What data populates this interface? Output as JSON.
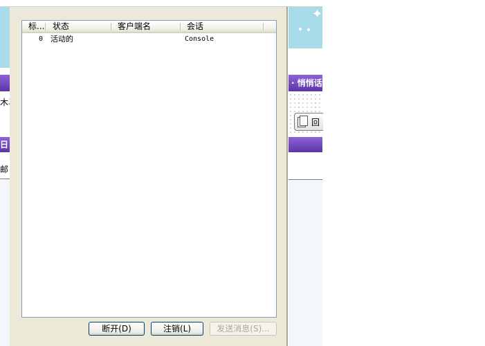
{
  "background": {
    "left_fragments": [
      "木马",
      "日",
      "邮"
    ],
    "right_banner": "· 悄悄话",
    "reply_button": "回"
  },
  "dialog": {
    "columns": [
      "标...",
      "状态",
      "客户端名",
      "会话"
    ],
    "rows": [
      {
        "id": "0",
        "status": "活动的",
        "client": "",
        "session": "Console"
      }
    ],
    "buttons": {
      "disconnect": "断开(D)",
      "logoff": "注销(L)",
      "send_message": "发送消息(S)..."
    }
  }
}
